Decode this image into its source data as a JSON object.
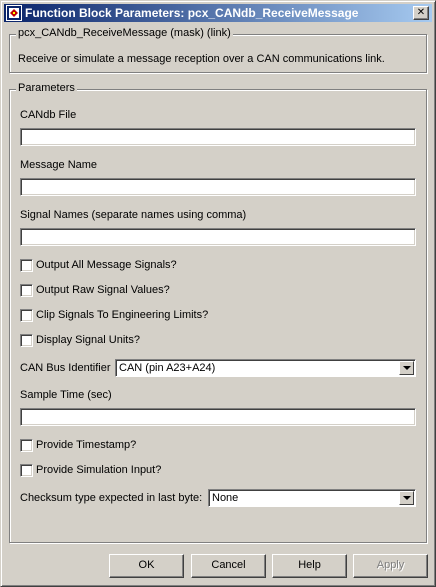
{
  "window": {
    "title": "Function Block Parameters: pcx_CANdb_ReceiveMessage",
    "close_label": "✕"
  },
  "mask": {
    "legend": "pcx_CANdb_ReceiveMessage (mask) (link)",
    "description": "Receive or simulate a message reception over a CAN communications link."
  },
  "parameters": {
    "legend": "Parameters",
    "candb_file": {
      "label": "CANdb File",
      "value": ""
    },
    "message_name": {
      "label": "Message Name",
      "value": ""
    },
    "signal_names": {
      "label": "Signal Names (separate names using comma)",
      "value": ""
    },
    "output_all": {
      "label": "Output All Message Signals?",
      "checked": false
    },
    "output_raw": {
      "label": "Output Raw Signal Values?",
      "checked": false
    },
    "clip_signals": {
      "label": "Clip Signals To Engineering Limits?",
      "checked": false
    },
    "display_units": {
      "label": "Display Signal Units?",
      "checked": false
    },
    "can_bus": {
      "label": "CAN Bus Identifier",
      "value": "CAN (pin A23+A24)"
    },
    "sample_time": {
      "label": "Sample Time (sec)",
      "value": ""
    },
    "provide_timestamp": {
      "label": "Provide Timestamp?",
      "checked": false
    },
    "provide_sim_input": {
      "label": "Provide Simulation Input?",
      "checked": false
    },
    "checksum": {
      "label": "Checksum type expected in last byte:",
      "value": "None"
    }
  },
  "buttons": {
    "ok": "OK",
    "cancel": "Cancel",
    "help": "Help",
    "apply": "Apply"
  },
  "colors": {
    "titlebar_start": "#0a246a",
    "titlebar_end": "#a6caf0",
    "face": "#d4d0c8"
  }
}
